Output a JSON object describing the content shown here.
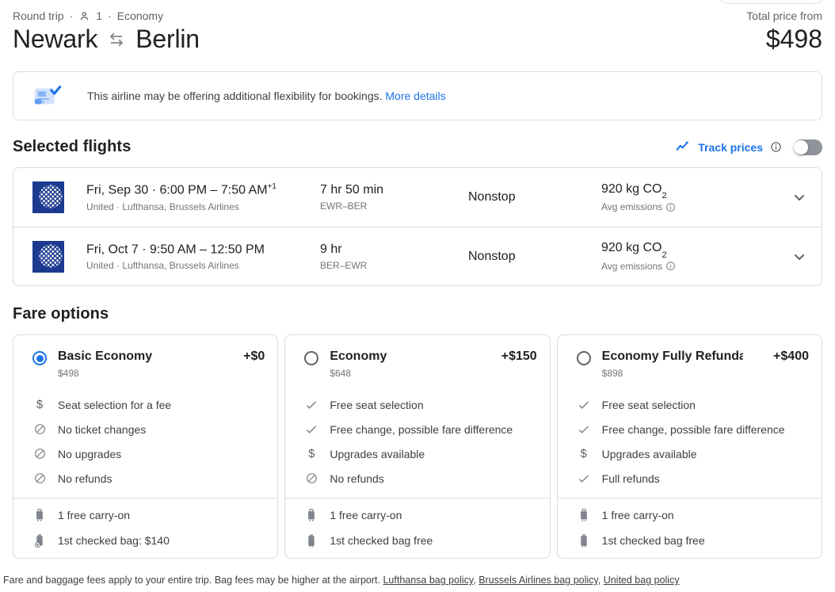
{
  "page": {
    "trip_summary": {
      "trip_type": "Round trip",
      "separator": "·",
      "passenger_count": "1",
      "cabin_class": "Economy"
    },
    "title": {
      "origin": "Newark",
      "destination": "Berlin"
    },
    "total_price": {
      "label": "Total price from",
      "amount": "$498"
    }
  },
  "banner": {
    "message": "This airline may be offering additional flexibility for bookings.",
    "link_label": "More details",
    "icon": "flexible-booking-icon"
  },
  "selected_flights": {
    "heading": "Selected flights",
    "track_prices": {
      "label": "Track prices",
      "icon": "trending-line-icon",
      "toggle_state": "off"
    },
    "flights": [
      {
        "datetime": "Fri, Sep 30 · 6:00 PM – 7:50 AM",
        "plus_days": "+1",
        "airlines": "United · Lufthansa, Brussels Airlines",
        "duration": "7 hr 50 min",
        "route": "EWR–BER",
        "stops": "Nonstop",
        "emissions_value": "920 kg CO",
        "emissions_subscript": "2",
        "emissions_caption": "Avg emissions"
      },
      {
        "datetime": "Fri, Oct 7 · 9:50 AM – 12:50 PM",
        "plus_days": "",
        "airlines": "United · Lufthansa, Brussels Airlines",
        "duration": "9 hr",
        "route": "BER–EWR",
        "stops": "Nonstop",
        "emissions_value": "920 kg CO",
        "emissions_subscript": "2",
        "emissions_caption": "Avg emissions"
      }
    ]
  },
  "fare_options": {
    "heading": "Fare options",
    "cards": [
      {
        "name": "Basic Economy",
        "price": "$498",
        "price_delta": "+$0",
        "selected": true,
        "features": [
          {
            "icon": "dollar",
            "text": "Seat selection for a fee"
          },
          {
            "icon": "not-allowed",
            "text": "No ticket changes"
          },
          {
            "icon": "not-allowed",
            "text": "No upgrades"
          },
          {
            "icon": "not-allowed",
            "text": "No refunds"
          }
        ],
        "baggage": [
          {
            "icon": "carry-on-bag",
            "text": "1 free carry-on"
          },
          {
            "icon": "checked-bag-add",
            "text": "1st checked bag: $140"
          }
        ]
      },
      {
        "name": "Economy",
        "price": "$648",
        "price_delta": "+$150",
        "selected": false,
        "features": [
          {
            "icon": "check",
            "text": "Free seat selection"
          },
          {
            "icon": "check",
            "text": "Free change, possible fare difference"
          },
          {
            "icon": "dollar",
            "text": "Upgrades available"
          },
          {
            "icon": "not-allowed",
            "text": "No refunds"
          }
        ],
        "baggage": [
          {
            "icon": "carry-on-bag",
            "text": "1 free carry-on"
          },
          {
            "icon": "checked-bag",
            "text": "1st checked bag free"
          }
        ]
      },
      {
        "name": "Economy Fully Refunda...",
        "price": "$898",
        "price_delta": "+$400",
        "selected": false,
        "features": [
          {
            "icon": "check",
            "text": "Free seat selection"
          },
          {
            "icon": "check",
            "text": "Free change, possible fare difference"
          },
          {
            "icon": "dollar",
            "text": "Upgrades available"
          },
          {
            "icon": "check",
            "text": "Full refunds"
          }
        ],
        "baggage": [
          {
            "icon": "carry-on-bag",
            "text": "1 free carry-on"
          },
          {
            "icon": "checked-bag",
            "text": "1st checked bag free"
          }
        ]
      }
    ]
  },
  "footer": {
    "text": "Fare and baggage fees apply to your entire trip. Bag fees may be higher at the airport.",
    "links": [
      "Lufthansa bag policy",
      "Brussels Airlines bag policy",
      "United bag policy"
    ],
    "separator": ","
  },
  "colors": {
    "accent_blue": "#1a73e8",
    "united_logo_blue": "#1c3b90",
    "border_gray": "#dadce0",
    "text_primary": "#202124",
    "text_secondary": "#70757a"
  }
}
